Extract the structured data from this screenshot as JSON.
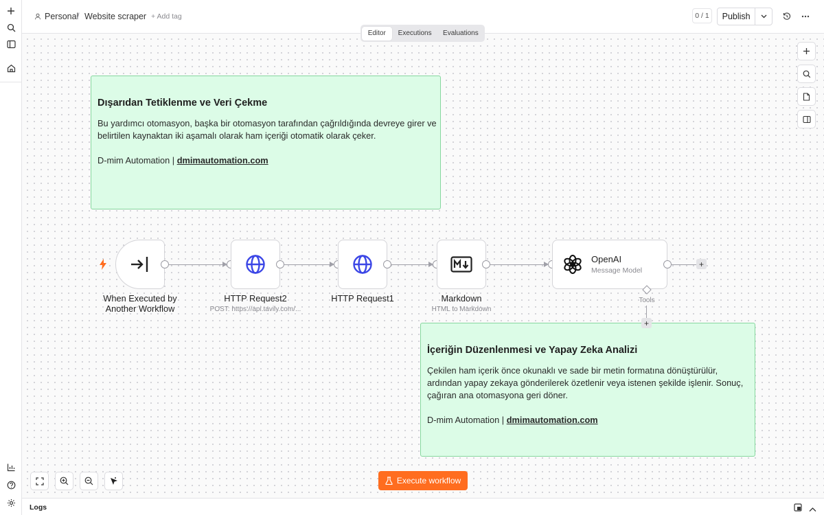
{
  "header": {
    "project": "Personal",
    "separator": "/",
    "workflow_name": "Website scraper",
    "add_tag": "+ Add tag",
    "counter": "0 / 1",
    "publish": "Publish"
  },
  "tabs": [
    "Editor",
    "Executions",
    "Evaluations"
  ],
  "sticky1": {
    "title": "Dışarıdan Tetiklenme ve Veri Çekme",
    "body": "Bu yardımcı otomasyon, başka bir otomasyon tarafından çağrıldığında devreye girer ve belirtilen kaynaktan iki aşamalı olarak ham içeriği otomatik olarak çeker.",
    "credit_prefix": "D-mim Automation | ",
    "credit_link": "dmimautomation.com"
  },
  "sticky2": {
    "title": "İçeriğin Düzenlenmesi ve Yapay Zeka Analizi",
    "body": "Çekilen ham içerik önce okunaklı ve sade bir metin formatına dönüştürülür, ardından yapay zekaya gönderilerek özetlenir veya istenen şekilde işlenir. Sonuç, çağıran ana otomasyona geri döner.",
    "credit_prefix": "D-mim Automation | ",
    "credit_link": "dmimautomation.com"
  },
  "nodes": {
    "trigger": {
      "label": "When Executed by Another Workflow"
    },
    "http2": {
      "label": "HTTP Request2",
      "sub": "POST: https://api.tavily.com/..."
    },
    "http1": {
      "label": "HTTP Request1"
    },
    "markdown": {
      "label": "Markdown",
      "sub": "HTML to Markdown"
    },
    "openai": {
      "label": "OpenAI",
      "sub": "Message Model",
      "tools_label": "Tools"
    }
  },
  "execute_button": "Execute workflow",
  "logs_label": "Logs",
  "colors": {
    "accent": "#ff6d1f",
    "sticky_bg": "#dcfce7",
    "sticky_border": "#86d79e",
    "http_icon": "#3b46e6",
    "trigger_bolt": "#ff6d1f"
  },
  "icons": {
    "rail": [
      "plus-icon",
      "search-icon",
      "panel-icon",
      "home-icon",
      "chart-icon",
      "help-icon",
      "settings-icon"
    ],
    "header": [
      "history-icon",
      "more-icon"
    ],
    "side_tools": [
      "plus-icon",
      "search-icon",
      "sticky-note-icon",
      "panel-right-icon"
    ],
    "bottom": [
      "fit-view-icon",
      "zoom-in-icon",
      "zoom-out-icon",
      "tidy-up-icon"
    ]
  }
}
